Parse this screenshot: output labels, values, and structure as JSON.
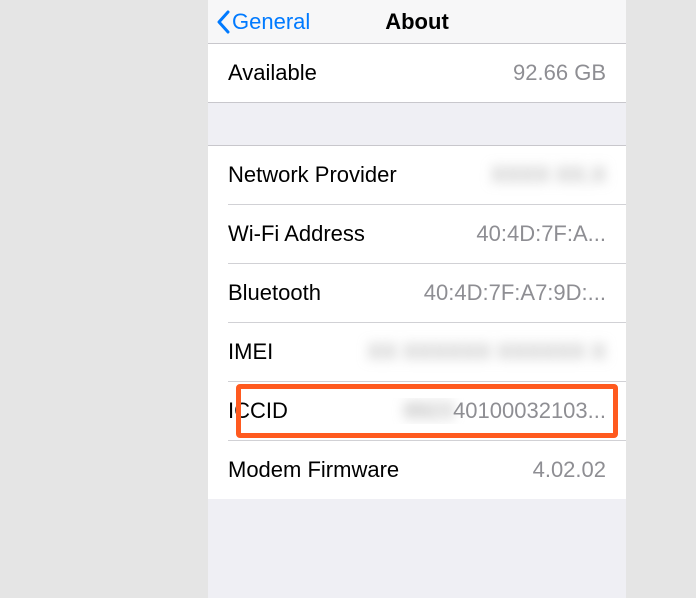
{
  "nav": {
    "back_label": "General",
    "title": "About"
  },
  "group1": {
    "available": {
      "label": "Available",
      "value": "92.66 GB"
    }
  },
  "group2": {
    "network_provider": {
      "label": "Network Provider",
      "value": "XXXX XX.X"
    },
    "wifi_address": {
      "label": "Wi-Fi Address",
      "value": "40:4D:7F:A..."
    },
    "bluetooth": {
      "label": "Bluetooth",
      "value": "40:4D:7F:A7:9D:..."
    },
    "imei": {
      "label": "IMEI",
      "value": "XX XXXXXX XXXXXX X"
    },
    "iccid": {
      "label": "ICCID",
      "hidden_prefix": "8923",
      "visible": "40100032103..."
    },
    "modem_firmware": {
      "label": "Modem Firmware",
      "value": "4.02.02"
    }
  },
  "highlight_color": "#ff5a1f"
}
